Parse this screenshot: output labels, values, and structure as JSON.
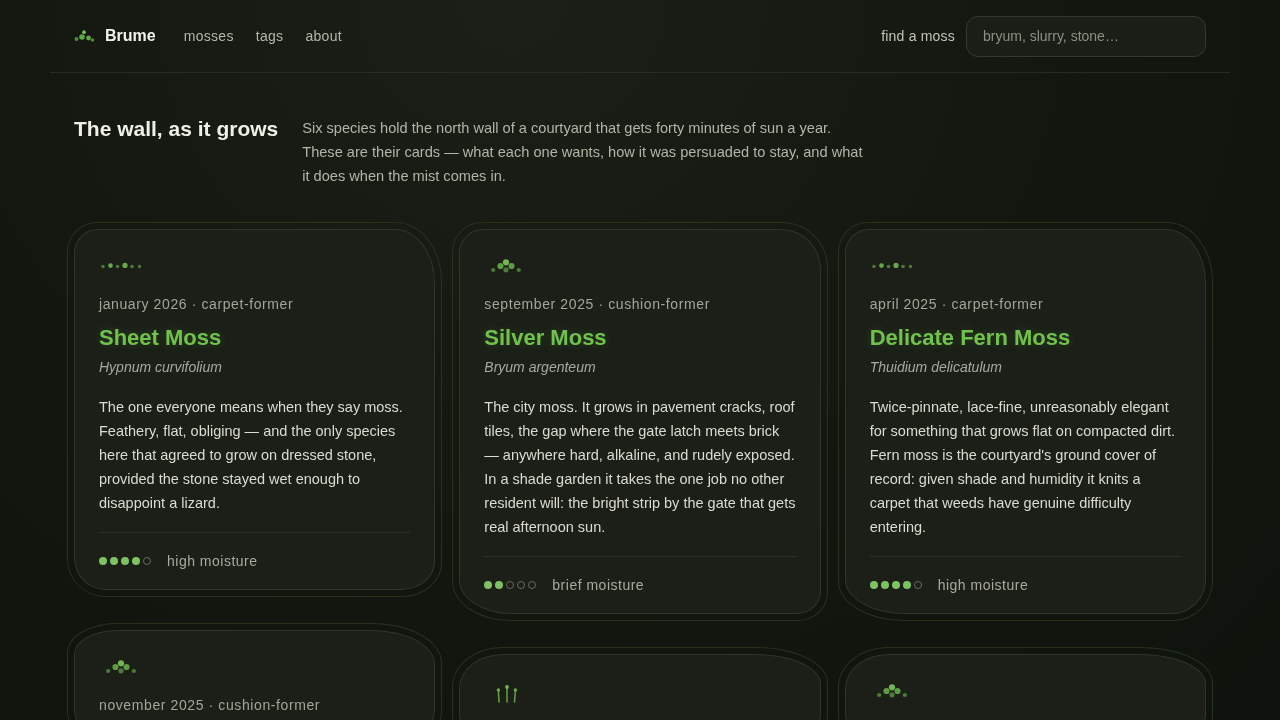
{
  "header": {
    "logo": "Brume",
    "nav": [
      {
        "label": "mosses"
      },
      {
        "label": "tags"
      },
      {
        "label": "about"
      }
    ],
    "search": {
      "label": "find a moss",
      "placeholder": "bryum, slurry, stone…"
    }
  },
  "intro": {
    "title": "The wall, as it grows",
    "text": "Six species hold the north wall of a courtyard that gets forty minutes of sun a year. These are their cards — what each one wants, how it was persuaded to stay, and what it does when the mist comes in."
  },
  "cards": [
    {
      "kind": "carpet",
      "meta": "january 2026 · carpet-former",
      "name": "Sheet Moss",
      "latin": "Hypnum curvifolium",
      "description": "The one everyone means when they say moss. Feathery, flat, obliging — and the only species here that agreed to grow on dressed stone, provided the stone stayed wet enough to disappoint a lizard.",
      "stars": 4,
      "moisture": "high moisture"
    },
    {
      "kind": "cushion",
      "meta": "september 2025 · cushion-former",
      "name": "Silver Moss",
      "latin": "Bryum argenteum",
      "description": "The city moss. It grows in pavement cracks, roof tiles, the gap where the gate latch meets brick — anywhere hard, alkaline, and rudely exposed. In a shade garden it takes the one job no other resident will: the bright strip by the gate that gets real afternoon sun.",
      "stars": 2,
      "moisture": "brief moisture"
    },
    {
      "kind": "carpet",
      "meta": "april 2025 · carpet-former",
      "name": "Delicate Fern Moss",
      "latin": "Thuidium delicatulum",
      "description": "Twice-pinnate, lace-fine, unreasonably elegant for something that grows flat on compacted dirt. Fern moss is the courtyard's ground cover of record: given shade and humidity it knits a carpet that weeds have genuine difficulty entering.",
      "stars": 4,
      "moisture": "high moisture"
    },
    {
      "kind": "cushion",
      "meta": "november 2025 · cushion-former"
    },
    {
      "kind": "stalks"
    },
    {
      "kind": "cushion"
    }
  ]
}
